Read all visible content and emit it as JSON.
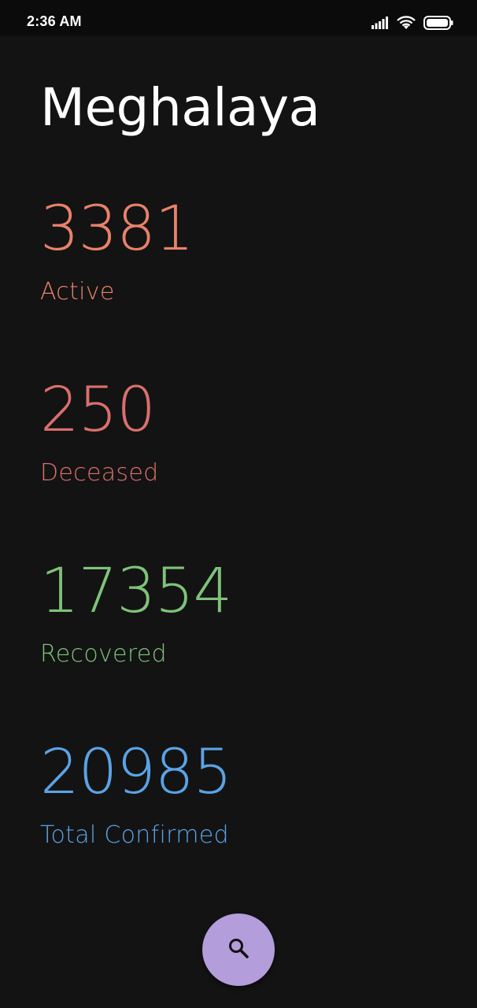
{
  "status_bar": {
    "time": "2:36 AM",
    "icons": [
      "signal-icon",
      "wifi-icon",
      "battery-icon"
    ]
  },
  "page": {
    "title": "Meghalaya"
  },
  "stats": [
    {
      "value": "3381",
      "label": "Active",
      "color": "#e8826a"
    },
    {
      "value": "250",
      "label": "Deceased",
      "color": "#d9706c"
    },
    {
      "value": "17354",
      "label": "Recovered",
      "color": "#7fc27a"
    },
    {
      "value": "20985",
      "label": "Total Confirmed",
      "color": "#5aa3e6"
    }
  ],
  "fab": {
    "icon": "search-icon",
    "color": "#b39ddb"
  }
}
